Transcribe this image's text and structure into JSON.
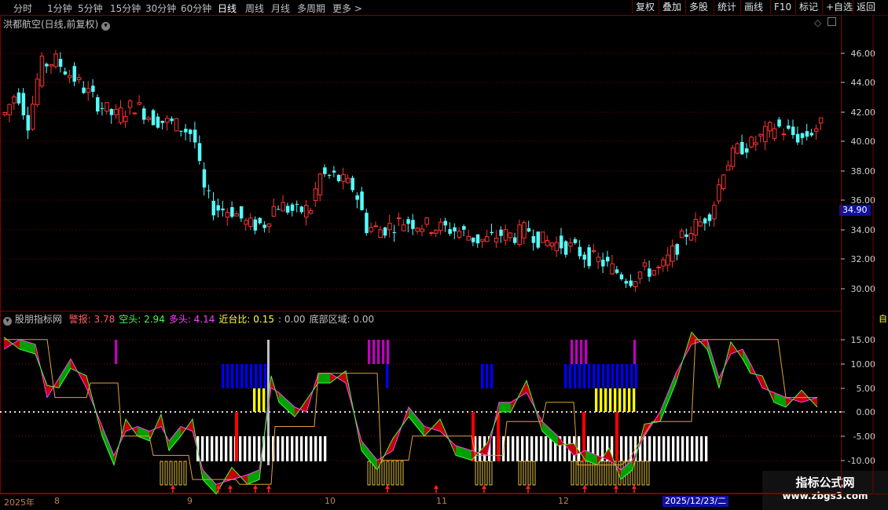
{
  "toolbar": {
    "periods": [
      "分时",
      "1分钟",
      "5分钟",
      "15分钟",
      "30分钟",
      "60分钟",
      "日线",
      "周线",
      "月线",
      "多周期",
      "更多"
    ],
    "active_period": "日线",
    "buttons": [
      "复权",
      "叠加",
      "多股",
      "统计",
      "画线",
      "F10",
      "标记",
      "+自选",
      "返回"
    ]
  },
  "main_chart": {
    "title": "洪都航空(日线,前复权)",
    "y_ticks": [
      "46.00",
      "44.00",
      "42.00",
      "40.00",
      "38.00",
      "36.00",
      "34.00",
      "32.00",
      "30.00"
    ],
    "current_price": "34.90"
  },
  "indicator": {
    "name": "股朋指标网",
    "items": [
      {
        "label": "警报:",
        "value": "3.78",
        "color": "#ff6060"
      },
      {
        "label": "空头:",
        "value": "2.94",
        "color": "#40ff40"
      },
      {
        "label": "多头:",
        "value": "4.14",
        "color": "#ff40ff"
      },
      {
        "label": "近台比:",
        "value": "0.15",
        "color": "#ffff40"
      },
      {
        "label": ":",
        "value": "0.00",
        "color": "#c0c0c0"
      },
      {
        "label": "底部区域:",
        "value": "0.00",
        "color": "#c0c0c0"
      }
    ],
    "y_ticks": [
      "15.00",
      "10.00",
      "5.00",
      "0.00",
      "-5.00",
      "-10.00"
    ]
  },
  "date_axis": {
    "labels": [
      "2025年",
      "8",
      "9",
      "10",
      "11",
      "12"
    ],
    "cursor_date": "2025/12/23/二"
  },
  "right_panel": {
    "top_label": "自"
  },
  "watermark": {
    "title": "指标公式网",
    "url": "www.zbgs3.com"
  },
  "colors": {
    "up": "#ff3232",
    "down": "#54fcfc",
    "grid": "#800000",
    "magenta": "#c000c0",
    "blue": "#0000ff",
    "yellow": "#ffff00",
    "white": "#ffffff",
    "red_bar": "#ff0000",
    "green_fill": "#00a000",
    "red_fill": "#c00000"
  }
}
